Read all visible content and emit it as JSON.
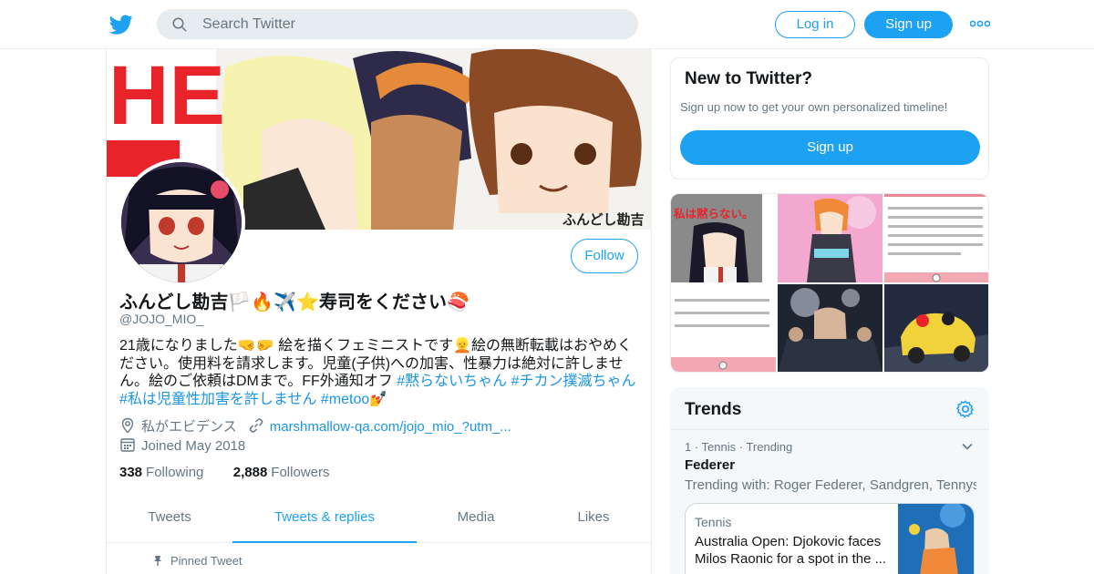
{
  "header": {
    "search_placeholder": "Search Twitter",
    "login_label": "Log in",
    "signup_label": "Sign up",
    "brand_color": "#1da1f2"
  },
  "profile": {
    "display_name": "ふんどし勘吉🏳️🔥✈️⭐寿司をください🍣",
    "handle": "@JOJO_MIO_",
    "follow_label": "Follow",
    "bio": {
      "text": "21歳になりました🤜🤛 絵を描くフェミニストです👱絵の無断転載はおやめください。使用料を請求します。児童(子供)への加害、性暴力は絶対に許しません。絵のご依頼はDMまで。FF外通知オフ ",
      "hashtag_1": "#黙らないちゃん",
      "hashtag_2": "#チカン撲滅ちゃん",
      "hashtag_3": "#私は児童性加害を許しません",
      "hashtag_4": "#metoo",
      "emoji_end": "💅"
    },
    "location": "私がエビデンス",
    "website": "marshmallow-qa.com/jojo_mio_?utm_...",
    "joined": "Joined May 2018",
    "following_count": "338",
    "following_label": "Following",
    "followers_count": "2,888",
    "followers_label": "Followers",
    "banner_signature": "ふんどし勘吉",
    "banner_text": "HE"
  },
  "tabs": [
    {
      "label": "Tweets",
      "active": false
    },
    {
      "label": "Tweets & replies",
      "active": true
    },
    {
      "label": "Media",
      "active": false
    },
    {
      "label": "Likes",
      "active": false
    }
  ],
  "pinned_label": "Pinned Tweet",
  "sidebar": {
    "new_to_twitter": {
      "title": "New to Twitter?",
      "subtitle": "Sign up now to get your own personalized timeline!",
      "button": "Sign up"
    },
    "media_grid": {
      "cell1_caption": "私は黙らない。"
    },
    "trends": {
      "title": "Trends",
      "items": [
        {
          "context": "1 · Tennis · Trending",
          "name": "Federer",
          "trending_with": "Trending with: Roger Federer, Sandgren, Tennys"
        }
      ],
      "card": {
        "source": "Tennis",
        "text": "Australia Open: Djokovic faces Milos Raonic for a spot in the ..."
      }
    }
  }
}
